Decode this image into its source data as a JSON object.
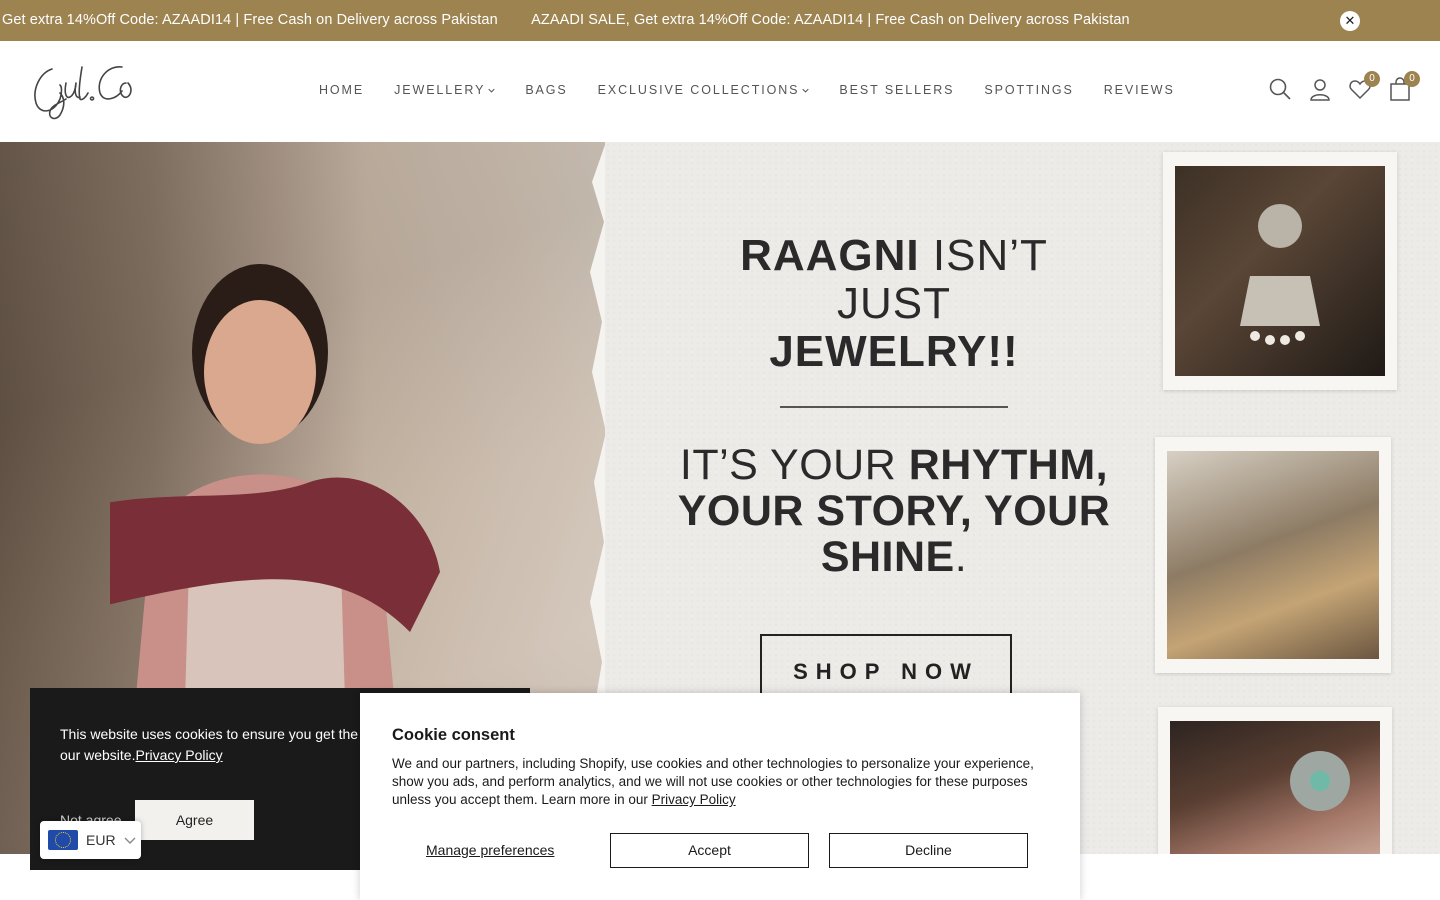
{
  "announcement": {
    "messages": [
      "Get extra 14%Off Code: AZAADI14 | Free Cash on Delivery across Pakistan",
      "AZAADI SALE, Get extra 14%Off Code: AZAADI14 | Free Cash on Delivery across Pakistan"
    ],
    "close_icon": "close-icon",
    "close_label": "✕"
  },
  "header": {
    "logo_text": "Gul.Co",
    "nav": [
      {
        "label": "HOME",
        "dropdown": false
      },
      {
        "label": "JEWELLERY",
        "dropdown": true
      },
      {
        "label": "BAGS",
        "dropdown": false
      },
      {
        "label": "EXCLUSIVE COLLECTIONS",
        "dropdown": true
      },
      {
        "label": "BEST SELLERS",
        "dropdown": false
      },
      {
        "label": "SPOTTINGS",
        "dropdown": false
      },
      {
        "label": "REVIEWS",
        "dropdown": false
      }
    ],
    "icons": {
      "search": "search-icon",
      "account": "user-icon",
      "wishlist": "heart-icon",
      "cart": "bag-icon"
    },
    "wishlist_count": "0",
    "cart_count": "0"
  },
  "hero": {
    "line1_bold": "RAAGNI",
    "line1_light": " ISN’T",
    "line2": "JUST",
    "line3": "JEWELRY!!",
    "line4_light": "IT’S YOUR ",
    "line4_bold": "RHYTHM,",
    "line5": "YOUR STORY, YOUR",
    "line6_bold": "SHINE",
    "line6_end": ".",
    "cta": "SHOP NOW"
  },
  "cookie_banner": {
    "text": "This website uses cookies to ensure you get the best experience on our website.",
    "policy_link": "Privacy Policy",
    "not_agree": "Not agree",
    "agree": "Agree"
  },
  "currency": {
    "code": "EUR",
    "flag": "eu-flag-icon"
  },
  "consent": {
    "title": "Cookie consent",
    "body": "We and our partners, including Shopify, use cookies and other technologies to personalize your experience, show you ads, and perform analytics, and we will not use cookies or other technologies for these purposes unless you accept them. Learn more in our ",
    "policy_link": "Privacy Policy",
    "manage": "Manage preferences",
    "accept": "Accept",
    "decline": "Decline"
  },
  "colors": {
    "announcement_bg": "#9d8350",
    "banner_bg": "#1a1a1a",
    "accent": "#9d8350"
  }
}
